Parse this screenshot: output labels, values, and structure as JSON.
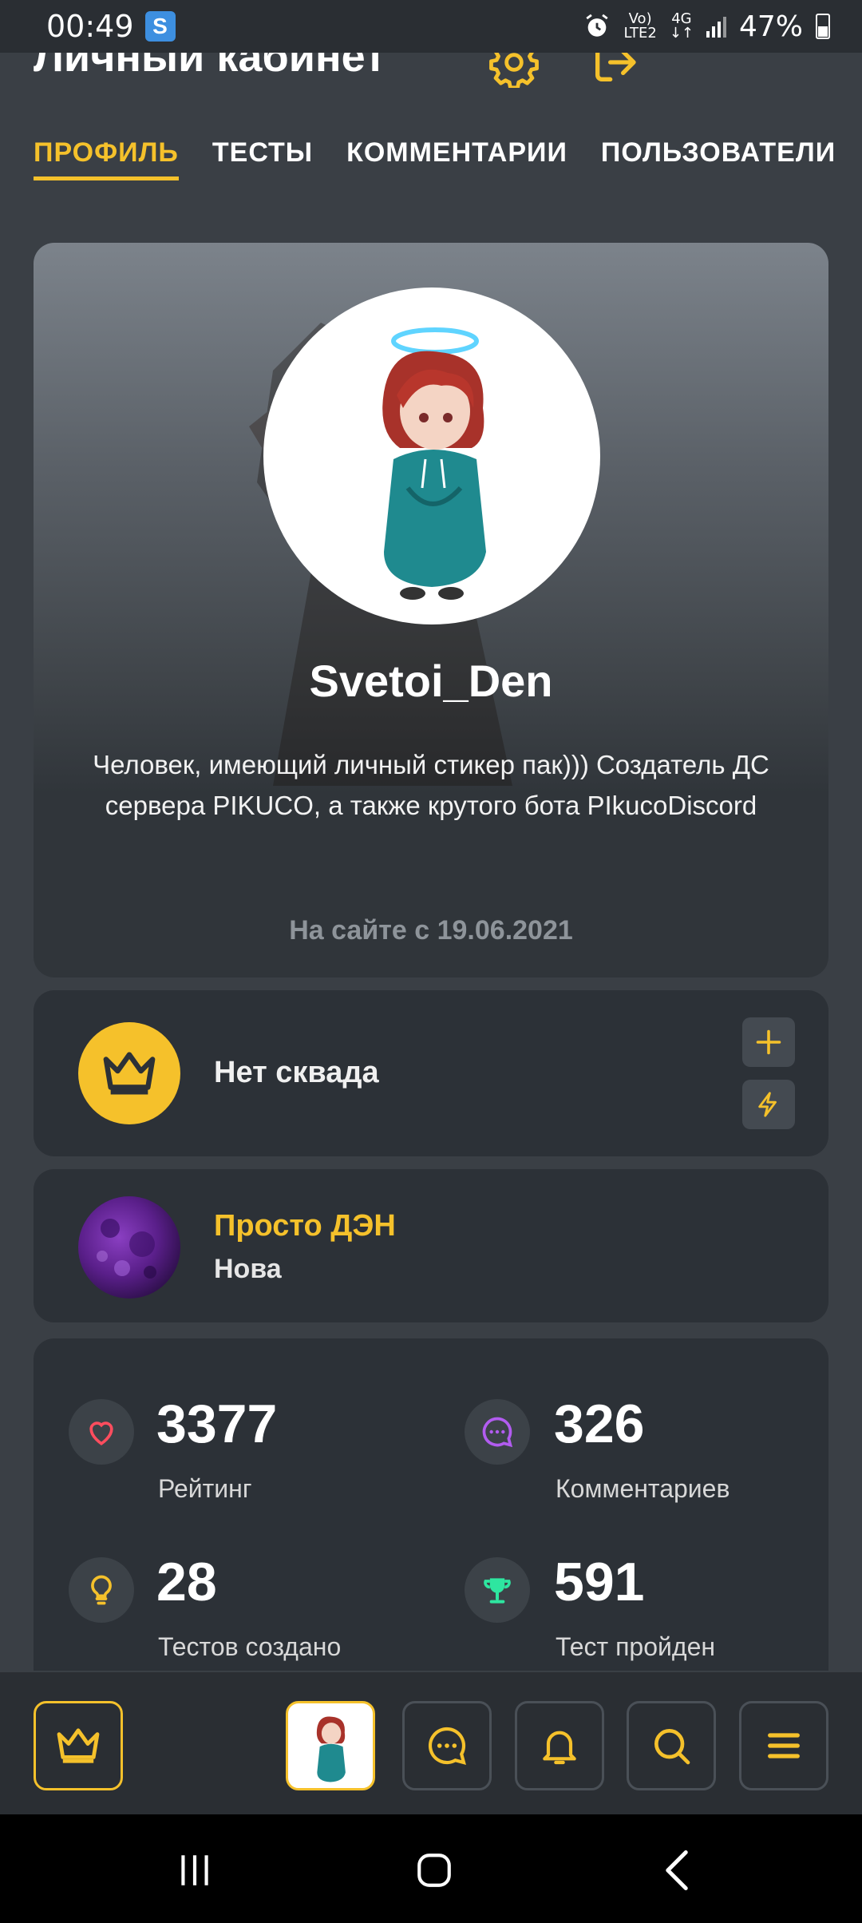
{
  "status_bar": {
    "time": "00:49",
    "app_icon_letter": "S",
    "network_top": "Vo)",
    "network_bottom": "LTE2",
    "network_4g": "4G",
    "battery_percent": "47%"
  },
  "header": {
    "title": "Личный кабинет"
  },
  "tabs": [
    {
      "label": "ПРОФИЛЬ",
      "active": true
    },
    {
      "label": "ТЕСТЫ",
      "active": false
    },
    {
      "label": "КОММЕНТАРИИ",
      "active": false
    },
    {
      "label": "ПОЛЬЗОВАТЕЛИ",
      "active": false
    }
  ],
  "profile": {
    "username": "Svetoi_Den",
    "bio": "Человек, имеющий личный стикер пак))) Создатель ДС сервера PIKUCO, а также крутого бота PIkucoDiscord",
    "since": "На сайте с 19.06.2021"
  },
  "squad": {
    "text": "Нет сквада"
  },
  "rank": {
    "title": "Просто ДЭН",
    "subtitle": "Нова"
  },
  "stats": [
    {
      "value": "3377",
      "label": "Рейтинг",
      "icon": "heart-icon",
      "color": "#ff4d5e"
    },
    {
      "value": "326",
      "label": "Комментариев",
      "icon": "comment-icon",
      "color": "#b25cf0"
    },
    {
      "value": "28",
      "label": "Тестов создано",
      "icon": "lightbulb-icon",
      "color": "#f5c12b"
    },
    {
      "value": "591",
      "label": "Тест пройден",
      "icon": "trophy-icon",
      "color": "#2ee6a0"
    }
  ],
  "colors": {
    "accent": "#f5c12b",
    "background": "#3a3f45",
    "card": "#2c3137"
  }
}
